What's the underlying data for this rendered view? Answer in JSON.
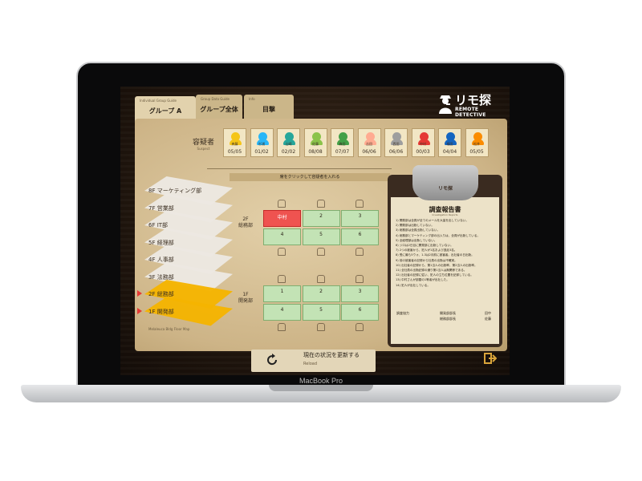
{
  "device": {
    "brand_label": "MacBook Pro"
  },
  "header": {
    "logo": {
      "title": "リモ探",
      "subtitle": "REMOTE DETECTIVE"
    },
    "tabs": [
      {
        "label": "グループ A",
        "sub": "Individual Group Guide",
        "active": true
      },
      {
        "label": "グループ全体",
        "sub": "Group Data Guide",
        "active": false
      },
      {
        "label": "目撃",
        "sub": "Info",
        "active": false
      }
    ]
  },
  "suspects": {
    "label": "容疑者",
    "label_en": "Suspect",
    "cards": [
      {
        "name": "斉藤",
        "date": "05/05",
        "color": "#f5c518"
      },
      {
        "name": "杉浦",
        "date": "01/02",
        "color": "#29b6f6"
      },
      {
        "name": "山崎",
        "date": "02/02",
        "color": "#26a69a"
      },
      {
        "name": "佐藤",
        "date": "08/08",
        "color": "#8bc34a"
      },
      {
        "name": "森田",
        "date": "07/07",
        "color": "#43a047"
      },
      {
        "name": "吉田",
        "date": "06/06",
        "color": "#ffab91"
      },
      {
        "name": "西田",
        "date": "06/06",
        "color": "#9e9e9e"
      },
      {
        "name": "中村",
        "date": "00/03",
        "color": "#e53935"
      },
      {
        "name": "福田",
        "date": "04/04",
        "color": "#1565c0"
      },
      {
        "name": "松井",
        "date": "05/05",
        "color": "#fb8c00"
      }
    ]
  },
  "instruction": "席をクリックして容疑者を入れる",
  "floors": [
    {
      "label": "8F マーケティング部",
      "active": false,
      "marker": false
    },
    {
      "label": "7F 営業部",
      "active": false,
      "marker": false
    },
    {
      "label": "6F IT部",
      "active": false,
      "marker": false
    },
    {
      "label": "5F 経理部",
      "active": false,
      "marker": false
    },
    {
      "label": "4F 人事部",
      "active": false,
      "marker": false
    },
    {
      "label": "3F 法務部",
      "active": false,
      "marker": false
    },
    {
      "label": "2F 総務部",
      "active": true,
      "marker": true
    },
    {
      "label": "1F 開発部",
      "active": true,
      "marker": true
    }
  ],
  "floor_map_label": "Melaleuca Bldg Floor Map",
  "departments": [
    {
      "floor": "2F",
      "name": "総務部",
      "desks": [
        {
          "num": "中村",
          "sub": "",
          "occupied": true
        },
        {
          "num": "2",
          "sub": "",
          "occupied": false
        },
        {
          "num": "3",
          "sub": "",
          "occupied": false
        },
        {
          "num": "4",
          "sub": "",
          "occupied": false
        },
        {
          "num": "5",
          "sub": "",
          "occupied": false
        },
        {
          "num": "6",
          "sub": "",
          "occupied": false
        }
      ]
    },
    {
      "floor": "1F",
      "name": "開発部",
      "desks": [
        {
          "num": "1",
          "sub": "",
          "occupied": false
        },
        {
          "num": "2",
          "sub": "",
          "occupied": false
        },
        {
          "num": "3",
          "sub": "",
          "occupied": false
        },
        {
          "num": "4",
          "sub": "",
          "occupied": false
        },
        {
          "num": "5",
          "sub": "",
          "occupied": false
        },
        {
          "num": "6",
          "sub": "",
          "occupied": false
        }
      ]
    }
  ],
  "report": {
    "clip_label": "リモ探",
    "title": "調査報告書",
    "title_en": "Investigation Reports",
    "lines": [
      "1) 開発部は全員が全てのメールを大量を出していない。",
      "2) 開発部は出勤していない。",
      "3) 総務部は全員出勤していない。",
      "4) 総務部とマーケティング部の出入りは、全員が出勤している。",
      "5) 全経理部は出勤していない。",
      "6) ジロは2日目に開発部に出勤していない。",
      "7) 2つの被害から、犯人が1名および逃走3名。",
      "8) 受に最も5ウォ、1-3は2月前に被害者。出社者の日出勤。",
      "9) 前の被害者の記録から社員の出勤は不確実。",
      "10) 出社者の記録から、第1当人の出勤率、第2当人の出勤率。",
      "11) 全社員の出勤記録の通り第1当人は無関係である。",
      "12) 出社者の記録に従い、犯人の立ち位置を記録している。",
      "13) 中村さんが部屋の1等者が出社した。",
      "14) 犯人が出社している。"
    ],
    "coop_label": "調査協力",
    "signers": [
      {
        "dept": "開発部部長",
        "name": "田中"
      },
      {
        "dept": "総務部部長",
        "name": "佐藤"
      }
    ]
  },
  "reload": {
    "label": "現在の状況を更新する",
    "sub": "Reload"
  }
}
